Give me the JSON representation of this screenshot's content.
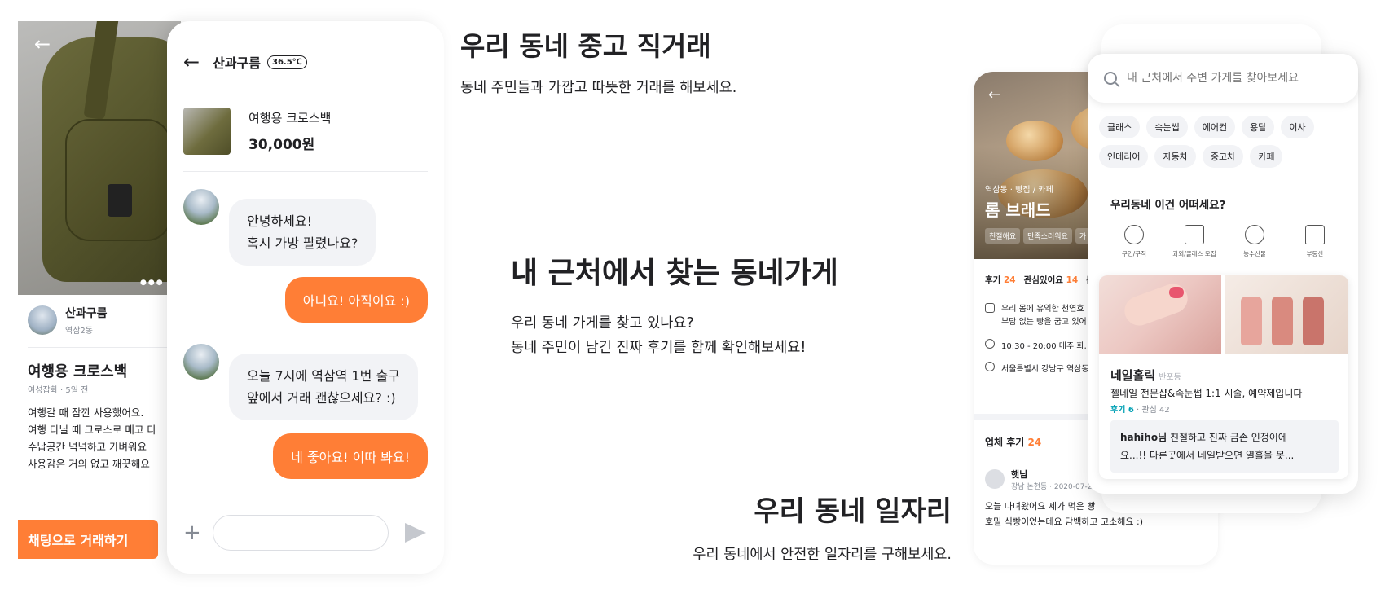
{
  "product": {
    "seller_name": "산과구름",
    "seller_location": "역삼2동",
    "title": "여행용 크로스백",
    "meta": "여성잡화 · 5일 전",
    "description": [
      "여행갈 때 잠깐 사용했어요.",
      "여행 다닐 때 크로스로 매고 다",
      "수납공간 넉넉하고 가벼워요",
      "사용감은 거의 없고 깨끗해요"
    ],
    "chat_button": "채팅으로 거래하기"
  },
  "chat": {
    "user_name": "산과구름",
    "temperature": "36.5℃",
    "product_name": "여행용 크로스백",
    "product_price": "30,000원",
    "messages": [
      {
        "from": "in",
        "lines": [
          "안녕하세요!",
          "혹시 가방 팔렸나요?"
        ]
      },
      {
        "from": "out",
        "text": "아니요! 아직이요 :)"
      },
      {
        "from": "in",
        "lines": [
          "오늘 7시에 역삼역 1번 출구",
          "앞에서 거래 괜찮으세요? :)"
        ]
      },
      {
        "from": "out",
        "text": "네 좋아요! 이따 봐요!"
      }
    ],
    "input_placeholder": ""
  },
  "sections": {
    "trade": {
      "title": "우리 동네 중고 직거래",
      "subtitle": "동네 주민들과 가깝고 따뜻한 거래를 해보세요."
    },
    "store": {
      "title": "내 근처에서 찾는 동네가게",
      "subtitle_lines": [
        "우리 동네 가게를 찾고 있나요?",
        "동네 주민이 남긴 진짜 후기를 함께 확인해보세요!"
      ]
    },
    "jobs": {
      "title": "우리 동네 일자리",
      "subtitle": "우리 동네에서 안전한 일자리를 구해보세요."
    }
  },
  "store_detail": {
    "category": "역삼동 · 빵집 / 카페",
    "name": "롬 브래드",
    "tags": [
      "친절해요",
      "만족스러워요",
      "가"
    ],
    "stats": {
      "review_label": "후기",
      "review_count": "24",
      "interest_label": "관심있어요",
      "interest_count": "14",
      "more_label": "문"
    },
    "info": [
      {
        "icon": "store-icon",
        "lines": [
          "우리 몸에 유익한 천연효",
          "부담 없는 빵을 굽고 있어"
        ]
      },
      {
        "icon": "clock-icon",
        "lines": [
          "10:30 - 20:00 매주 화, 수"
        ]
      },
      {
        "icon": "pin-icon",
        "lines": [
          "서울특별시 강남구 역삼동"
        ]
      }
    ],
    "reviews_label": "업체 후기",
    "reviews_count": "24",
    "review": {
      "author": "햇님",
      "meta": "강남 논현동 · 2020-07-29",
      "lines": [
        "오늘 다녀왔어요 제가 먹은 빵",
        "호밀 식빵이었는데요 담백하고 고소해요 :)"
      ]
    }
  },
  "search_panel": {
    "placeholder": "내 근처에서 주변 가게를 찾아보세요",
    "chips": [
      "클래스",
      "속눈썹",
      "에어컨",
      "용달",
      "이사",
      "인테리어",
      "자동차",
      "중고차",
      "카페"
    ],
    "rec_title": "우리동네 이건 어떠세요?",
    "categories": [
      {
        "icon": "job-icon",
        "label": "구인/구직"
      },
      {
        "icon": "lesson-icon",
        "label": "과외/클래스 모집"
      },
      {
        "icon": "produce-icon",
        "label": "농수산물"
      },
      {
        "icon": "realestate-icon",
        "label": "부동산"
      }
    ],
    "card": {
      "name": "네일홀릭",
      "location": "반포동",
      "description": "젤네일 전문샵&속눈썹 1:1 시술, 예약제입니다",
      "review_label": "후기 6",
      "interest": "· 관심 42",
      "review_author": "hahiho님",
      "review_lines": [
        " 친절하고 진짜 금손 인정이에",
        "요...!! 다른곳에서 네일받으면 열흘을 못..."
      ]
    }
  },
  "colors": {
    "accent": "#ff7e36",
    "teal": "#00a0b4",
    "text": "#212124",
    "gray": "#868b94"
  }
}
